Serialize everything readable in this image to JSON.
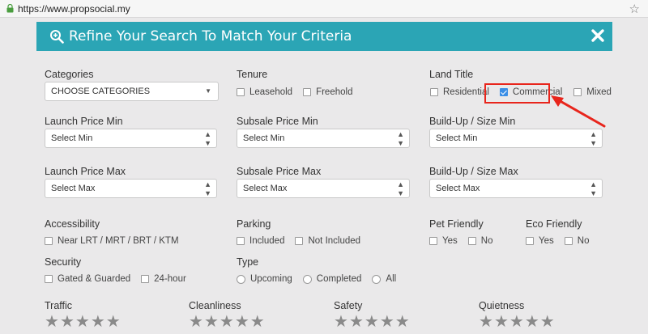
{
  "browser": {
    "url": "https://www.propsocial.my"
  },
  "header": {
    "title": "Refine Your Search To Match Your Criteria"
  },
  "categories": {
    "label": "Categories",
    "value": "CHOOSE CATEGORIES"
  },
  "tenure": {
    "label": "Tenure",
    "options": [
      "Leasehold",
      "Freehold"
    ]
  },
  "land_title": {
    "label": "Land Title",
    "options": [
      "Residential",
      "Commercial",
      "Mixed"
    ],
    "checked": "Commercial"
  },
  "launch_min": {
    "label": "Launch Price Min",
    "value": "Select Min"
  },
  "subsale_min": {
    "label": "Subsale Price Min",
    "value": "Select Min"
  },
  "buildup_min": {
    "label": "Build-Up / Size Min",
    "value": "Select Min"
  },
  "launch_max": {
    "label": "Launch Price Max",
    "value": "Select Max"
  },
  "subsale_max": {
    "label": "Subsale Price Max",
    "value": "Select Max"
  },
  "buildup_max": {
    "label": "Build-Up / Size Max",
    "value": "Select Max"
  },
  "accessibility": {
    "label": "Accessibility",
    "options": [
      "Near LRT / MRT / BRT / KTM"
    ]
  },
  "parking": {
    "label": "Parking",
    "options": [
      "Included",
      "Not Included"
    ]
  },
  "pet_friendly": {
    "label": "Pet Friendly",
    "options": [
      "Yes",
      "No"
    ]
  },
  "eco_friendly": {
    "label": "Eco Friendly",
    "options": [
      "Yes",
      "No"
    ]
  },
  "security": {
    "label": "Security",
    "options": [
      "Gated & Guarded",
      "24-hour"
    ]
  },
  "type": {
    "label": "Type",
    "options": [
      "Upcoming",
      "Completed",
      "All"
    ]
  },
  "ratings": [
    {
      "label": "Traffic",
      "stars": 5
    },
    {
      "label": "Cleanliness",
      "stars": 5
    },
    {
      "label": "Safety",
      "stars": 5
    },
    {
      "label": "Quietness",
      "stars": 5
    }
  ],
  "colors": {
    "header": "#2ba5b5",
    "highlight": "#e8251c",
    "check": "#3a8ee6"
  }
}
